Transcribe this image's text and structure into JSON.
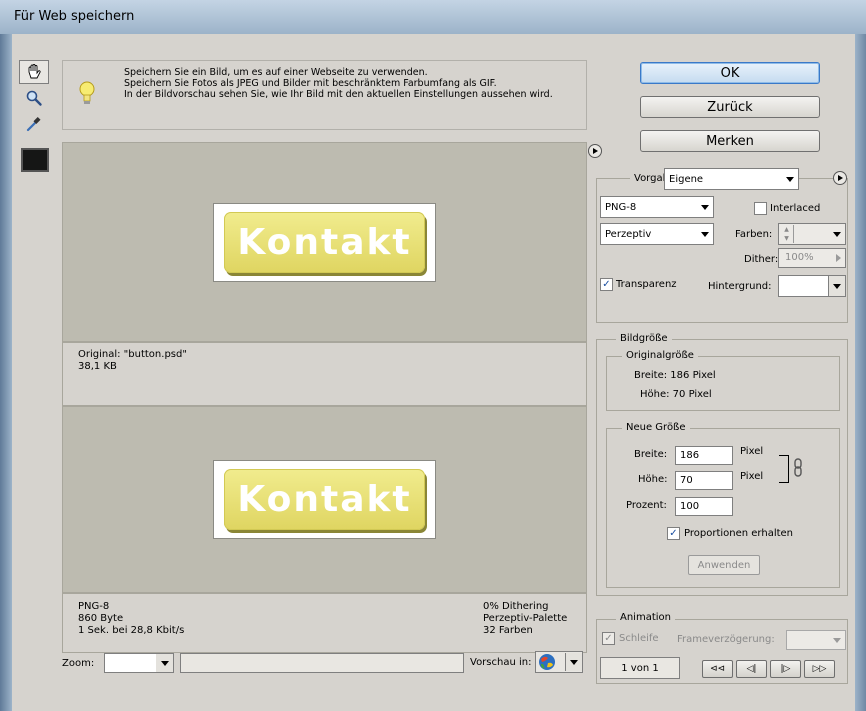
{
  "window": {
    "title": "Für Web speichern"
  },
  "tools": [
    "hand-tool",
    "zoom-tool",
    "eyedropper-tool"
  ],
  "colors": {
    "swatch": "#151615",
    "preview_bg": "#bdbbb0",
    "button_yellow": "#e6dd6e",
    "ok_accent": "#3a79c8"
  },
  "tip": {
    "line1": "Speichern Sie ein Bild, um es auf einer Webseite zu verwenden.",
    "line2": "Speichern Sie Fotos als JPEG und Bilder mit beschränktem Farbumfang als GIF.",
    "line3": "In der Bildvorschau sehen Sie, wie Ihr Bild mit den aktuellen Einstellungen aussehen wird."
  },
  "preview_original": {
    "image_text": "Kontakt",
    "name": "Original: \"button.psd\"",
    "size": "38,1 KB"
  },
  "preview_optimized": {
    "image_text": "Kontakt",
    "format": "PNG-8",
    "bytes": "860 Byte",
    "speed": "1 Sek. bei 28,8 Kbit/s",
    "dithering": "0% Dithering",
    "palette": "Perzeptiv-Palette",
    "colors": "32 Farben"
  },
  "bottom": {
    "zoom_label": "Zoom:",
    "zoom_value": "",
    "status": "",
    "preview_in": "Vorschau in:"
  },
  "buttons": {
    "ok": "OK",
    "back": "Zurück",
    "save": "Merken"
  },
  "settings": {
    "preset_label": "Vorgabe:",
    "preset_value": "Eigene",
    "format_value": "PNG-8",
    "interlaced": "Interlaced",
    "reduction_value": "Perzeptiv",
    "colors_label": "Farben:",
    "dither_label": "Dither:",
    "dither_value": "100%",
    "transparency": "Transparenz",
    "matte_label": "Hintergrund:"
  },
  "image_size": {
    "title": "Bildgröße",
    "original_title": "Originalgröße",
    "orig_width": "Breite: 186 Pixel",
    "orig_height": "Höhe: 70 Pixel",
    "new_title": "Neue Größe",
    "width_label": "Breite:",
    "width_value": "186",
    "width_unit": "Pixel",
    "height_label": "Höhe:",
    "height_value": "70",
    "height_unit": "Pixel",
    "percent_label": "Prozent:",
    "percent_value": "100",
    "constrain": "Proportionen erhalten",
    "apply": "Anwenden"
  },
  "animation": {
    "title": "Animation",
    "loop": "Schleife",
    "frame_delay": "Frameverzögerung:",
    "frame_counter": "1 von 1"
  }
}
